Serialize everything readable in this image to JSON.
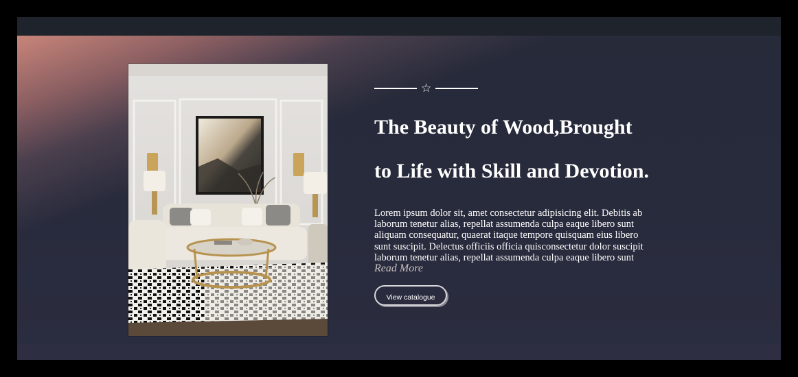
{
  "hero": {
    "ornament_icon": "star-outline-icon",
    "headline_line1": "The Beauty of Wood,Brought",
    "headline_line2": "to Life with Skill and Devotion.",
    "description": "Lorem ipsum dolor sit, amet consectetur adipisicing elit. Debitis ab laborum tenetur alias, repellat assumenda culpa eaque libero sunt aliquam consequatur, quaerat itaque tempore quisquam eius libero sunt suscipit. Delectus officiis officia quisconsectetur dolor suscipit laborum tenetur alias, repellat assumenda culpa eaque libero sunt",
    "read_more": "Read More",
    "button_label": "View catalogue",
    "image_subject": "living-room-interior-photo"
  },
  "colors": {
    "page_background": "#000000",
    "section_background": "#262a39",
    "accent_gradient": "#c88579",
    "text": "#ffffff",
    "read_more": "#c9c0c0"
  }
}
